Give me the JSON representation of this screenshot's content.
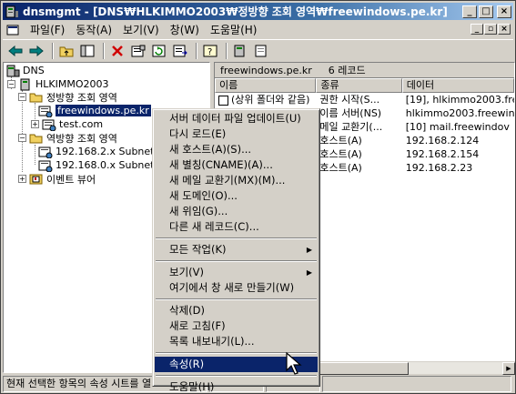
{
  "window": {
    "title": "dnsmgmt - [DNS₩HLKIMMO2003₩정방향 조회 영역₩freewindows.pe.kr]",
    "min_label": "_",
    "max_label": "□",
    "close_label": "×"
  },
  "menubar": {
    "items": [
      "파일(F)",
      "동작(A)",
      "보기(V)",
      "창(W)",
      "도움말(H)"
    ],
    "mdi_min": "_",
    "mdi_restore": "▫",
    "mdi_close": "×"
  },
  "toolbar": {
    "icons": [
      "back-arrow-icon",
      "forward-arrow-icon",
      "up-folder-icon",
      "show-tree-icon",
      "delete-icon",
      "properties-icon",
      "refresh-icon",
      "export-list-icon",
      "help-icon",
      "server-icon",
      "record-icon"
    ]
  },
  "tree": {
    "root": "DNS",
    "server": "HLKIMMO2003",
    "forward_zones": "정방향 조회 영역",
    "zone_selected": "freewindows.pe.kr",
    "zone_other": "test.com",
    "reverse_zones": "역방향 조회 영역",
    "reverse_1": "192.168.2.x Subnet",
    "reverse_2": "192.168.0.x Subnet",
    "event_viewer": "이벤트 뷰어"
  },
  "right_pane": {
    "header_name": "freewindows.pe.kr",
    "header_count": "6 레코드",
    "columns": [
      "이름",
      "종류",
      "데이터"
    ],
    "rows": [
      {
        "name": "(상위 폴더와 같음)",
        "type": "권한 시작(S...",
        "data": "[19], hlkimmo2003.free"
      },
      {
        "name": "",
        "type": "이름 서버(NS)",
        "data": "hlkimmo2003.freewin"
      },
      {
        "name": "",
        "type": "메일 교환기(...",
        "data": "[10]  mail.freewindov"
      },
      {
        "name": "",
        "type": "호스트(A)",
        "data": "192.168.2.124"
      },
      {
        "name": "",
        "type": "호스트(A)",
        "data": "192.168.2.154"
      },
      {
        "name": "",
        "type": "호스트(A)",
        "data": "192.168.2.23"
      }
    ]
  },
  "context_menu": {
    "items": [
      {
        "label": "서버 데이터 파일 업데이트(U)"
      },
      {
        "label": "다시 로드(E)"
      },
      {
        "label": "새 호스트(A)(S)..."
      },
      {
        "label": "새 별칭(CNAME)(A)..."
      },
      {
        "label": "새 메일 교환기(MX)(M)..."
      },
      {
        "label": "새 도메인(O)..."
      },
      {
        "label": "새 위임(G)..."
      },
      {
        "label": "다른 새 레코드(C)..."
      },
      {
        "label": "모든 작업(K)",
        "submenu": true
      },
      {
        "label": "보기(V)",
        "submenu": true
      },
      {
        "label": "여기에서 창 새로 만들기(W)"
      },
      {
        "label": "삭제(D)"
      },
      {
        "label": "새로 고침(F)"
      },
      {
        "label": "목록 내보내기(L)..."
      },
      {
        "label": "속성(R)",
        "highlight": true
      },
      {
        "label": "도움말(H)"
      }
    ],
    "submenu_arrow": "▶"
  },
  "statusbar": {
    "text": "현재 선택한 항목의 속성 시트를 열"
  }
}
